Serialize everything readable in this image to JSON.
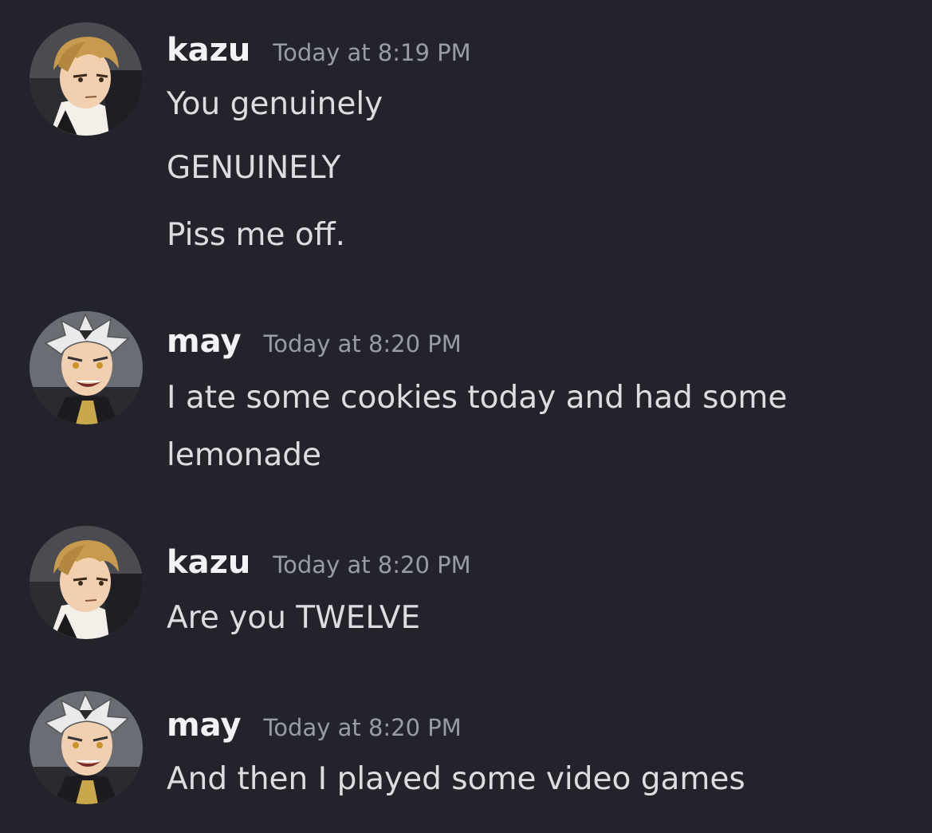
{
  "messages": [
    {
      "username": "kazu",
      "timestamp": "Today at 8:19 PM",
      "avatar": "kazu-avatar",
      "lines": [
        "You genuinely",
        "GENUINELY",
        "Piss me off."
      ]
    },
    {
      "username": "may",
      "timestamp": "Today at 8:20 PM",
      "avatar": "may-avatar",
      "lines": [
        "I ate some cookies today and had some",
        "lemonade"
      ]
    },
    {
      "username": "kazu",
      "timestamp": "Today at 8:20 PM",
      "avatar": "kazu-avatar",
      "lines": [
        "Are you TWELVE"
      ]
    },
    {
      "username": "may",
      "timestamp": "Today at 8:20 PM",
      "avatar": "may-avatar",
      "lines": [
        "And then I played some video games"
      ]
    }
  ],
  "colors": {
    "background": "#22232b",
    "username": "#f2f3f5",
    "timestamp": "#9a9ca3",
    "message_text": "#dcdde1"
  }
}
